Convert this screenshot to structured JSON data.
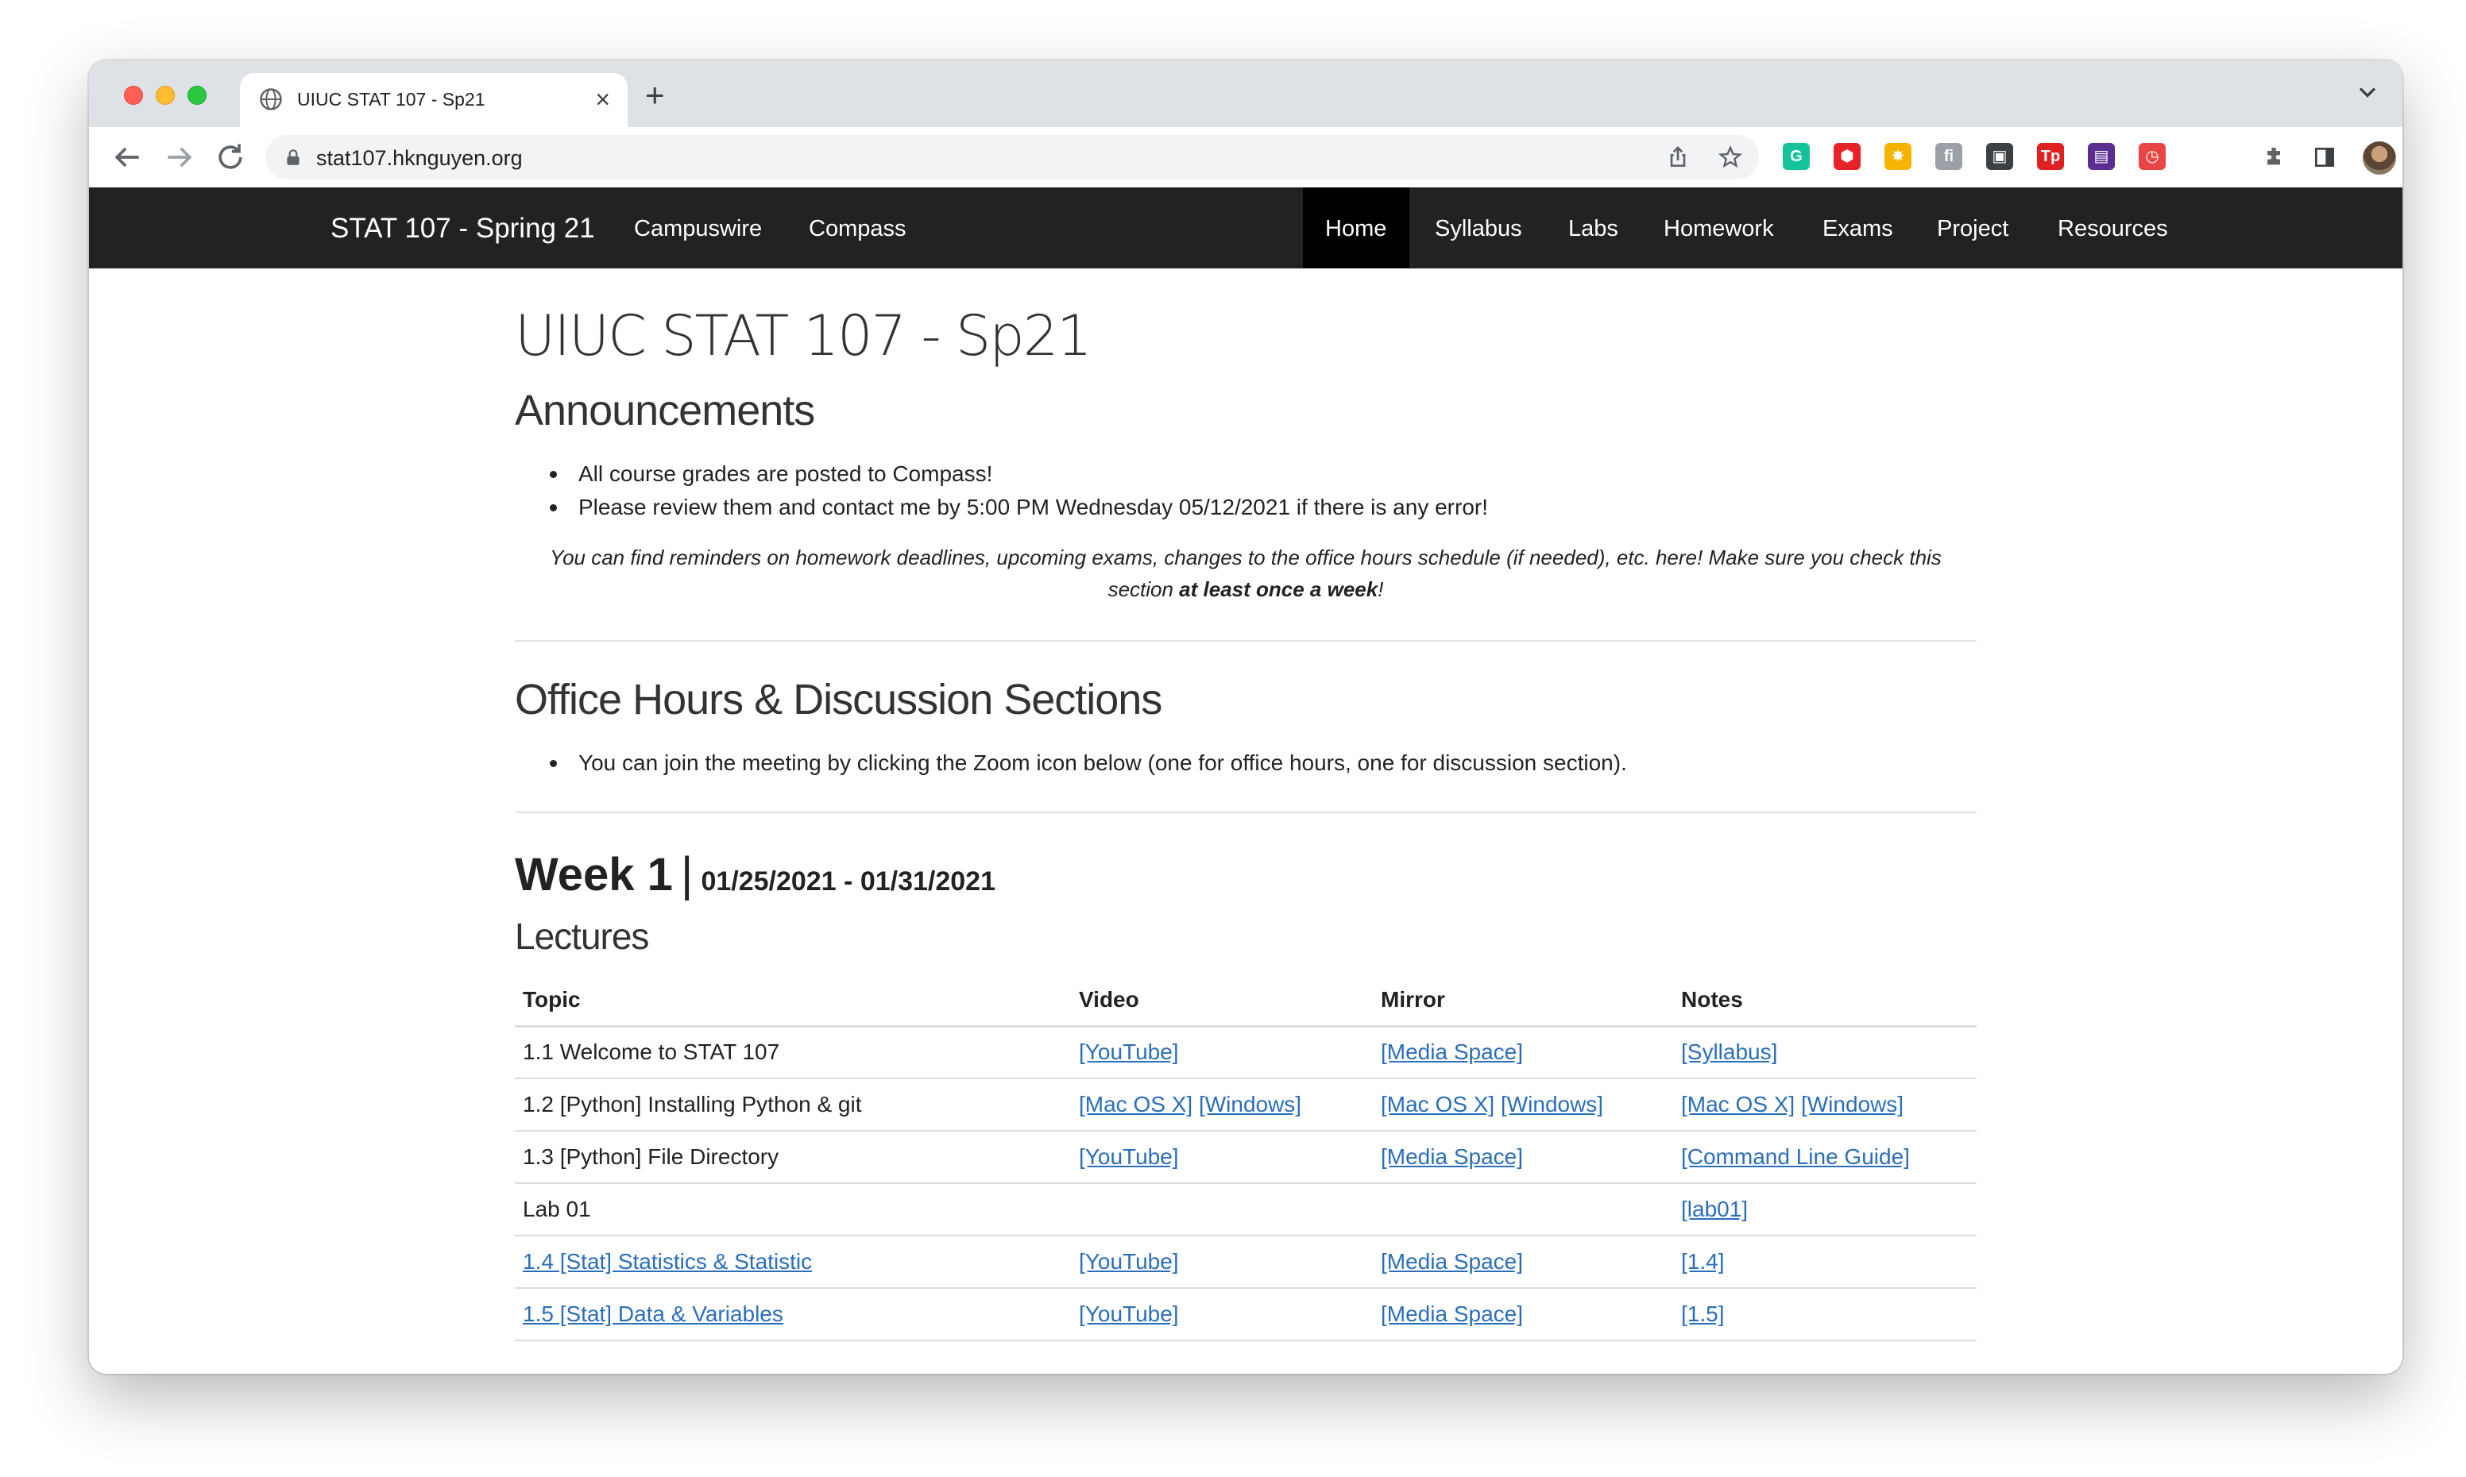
{
  "browser": {
    "tab_title": "UIUC STAT 107 - Sp21",
    "url": "stat107.hknguyen.org",
    "extensions": [
      {
        "name": "grammarly-icon",
        "color": "#15c39a",
        "glyph": "G"
      },
      {
        "name": "adblock-icon",
        "color": "#e8222b",
        "glyph": "⬢"
      },
      {
        "name": "color-wheel-icon",
        "color": "#f4b400",
        "glyph": "✸"
      },
      {
        "name": "tex-icon",
        "color": "#9aa0a6",
        "glyph": "fi"
      },
      {
        "name": "picture-in-picture-icon",
        "color": "#3c4043",
        "glyph": "▣"
      },
      {
        "name": "tp-icon",
        "color": "#e02020",
        "glyph": "Tp"
      },
      {
        "name": "purple-box-icon",
        "color": "#5b2d90",
        "glyph": "▤"
      },
      {
        "name": "timer-icon",
        "color": "#e84545",
        "glyph": "◷"
      }
    ]
  },
  "site": {
    "brand": "STAT 107 - Spring 21",
    "left_links": [
      "Campuswire",
      "Compass"
    ],
    "right_links": [
      "Home",
      "Syllabus",
      "Labs",
      "Homework",
      "Exams",
      "Project",
      "Resources"
    ],
    "active": "Home"
  },
  "page": {
    "title": "UIUC STAT 107 - Sp21",
    "announcements_heading": "Announcements",
    "announcements": [
      "All course grades are posted to Compass!",
      "Please review them and contact me by 5:00 PM Wednesday 05/12/2021 if there is any error!"
    ],
    "note_part1": "You can find reminders on homework deadlines, upcoming exams, changes to the office hours schedule (if needed), etc. here! Make sure you check this section ",
    "note_bold": "at least once a week",
    "note_end": "!",
    "office_heading": "Office Hours & Discussion Sections",
    "office_items": [
      "You can join the meeting by clicking the Zoom icon below (one for office hours, one for discussion section)."
    ],
    "week_label": "Week 1",
    "week_sep": "|",
    "week_range": "01/25/2021 - 01/31/2021",
    "lectures_heading": "Lectures"
  },
  "lectures": {
    "headers": [
      "Topic",
      "Video",
      "Mirror",
      "Notes"
    ],
    "rows": [
      {
        "topic": "1.1 Welcome to STAT 107",
        "topic_link": false,
        "video": [
          "[YouTube]"
        ],
        "mirror": [
          "[Media Space]"
        ],
        "notes": [
          "[Syllabus]"
        ]
      },
      {
        "topic": "1.2 [Python] Installing Python & git",
        "topic_link": false,
        "video": [
          "[Mac OS X]",
          "[Windows]"
        ],
        "mirror": [
          "[Mac OS X]",
          "[Windows]"
        ],
        "notes": [
          "[Mac OS X]",
          "[Windows]"
        ]
      },
      {
        "topic": "1.3 [Python] File Directory",
        "topic_link": false,
        "video": [
          "[YouTube]"
        ],
        "mirror": [
          "[Media Space]"
        ],
        "notes": [
          "[Command Line Guide]"
        ]
      },
      {
        "topic": "Lab 01",
        "topic_link": false,
        "video": [],
        "mirror": [],
        "notes": [
          "[lab01]"
        ]
      },
      {
        "topic": "1.4 [Stat] Statistics & Statistic",
        "topic_link": true,
        "video": [
          "[YouTube]"
        ],
        "mirror": [
          "[Media Space]"
        ],
        "notes": [
          "[1.4]"
        ]
      },
      {
        "topic": "1.5 [Stat] Data & Variables",
        "topic_link": true,
        "video": [
          "[YouTube]"
        ],
        "mirror": [
          "[Media Space]"
        ],
        "notes": [
          "[1.5]"
        ]
      }
    ]
  }
}
